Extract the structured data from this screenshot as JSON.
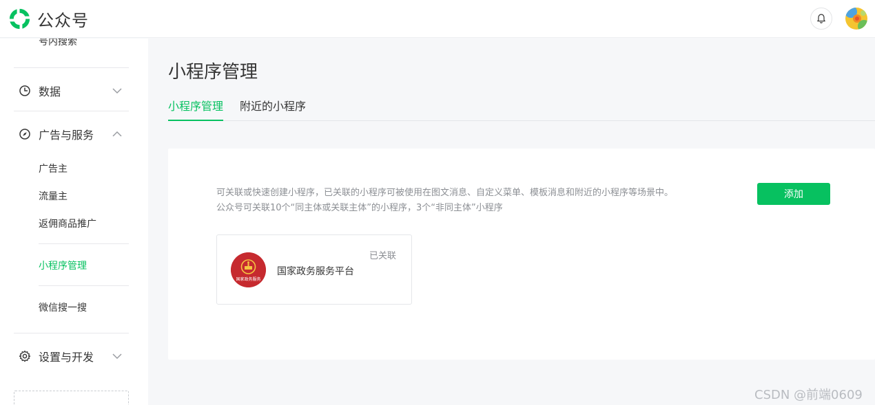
{
  "header": {
    "brand": "公众号",
    "bell_icon": "bell-icon",
    "avatar_icon": "user-avatar"
  },
  "sidebar": {
    "top_partial_item": "号内搜索",
    "groups": [
      {
        "label": "数据",
        "icon": "pie-chart-icon",
        "expanded": false
      },
      {
        "label": "广告与服务",
        "icon": "compass-icon",
        "expanded": true
      },
      {
        "label": "设置与开发",
        "icon": "gear-icon",
        "expanded": false
      }
    ],
    "items": [
      {
        "label": "广告主",
        "active": false
      },
      {
        "label": "流量主",
        "active": false
      },
      {
        "label": "返佣商品推广",
        "active": false
      },
      {
        "label": "小程序管理",
        "active": true
      },
      {
        "label": "微信搜一搜",
        "active": false
      }
    ]
  },
  "main": {
    "title": "小程序管理",
    "tabs": [
      {
        "label": "小程序管理",
        "active": true
      },
      {
        "label": "附近的小程序",
        "active": false
      }
    ],
    "description_line1": "可关联或快速创建小程序，已关联的小程序可被使用在图文消息、自定义菜单、模板消息和附近的小程序等场景中。",
    "description_line2": "公众号可关联10个“同主体或关联主体”的小程序，3个“非同主体”小程序",
    "add_button": "添加",
    "mini_programs": [
      {
        "name": "国家政务服务平台",
        "status": "已关联",
        "logo_text": "国家政务服务"
      }
    ]
  },
  "watermark": "CSDN @前端0609",
  "colors": {
    "accent": "#07c160",
    "text": "#353535",
    "muted": "#8c8f94",
    "background": "#f6f7f9",
    "logo_red": "#c62a2f"
  }
}
